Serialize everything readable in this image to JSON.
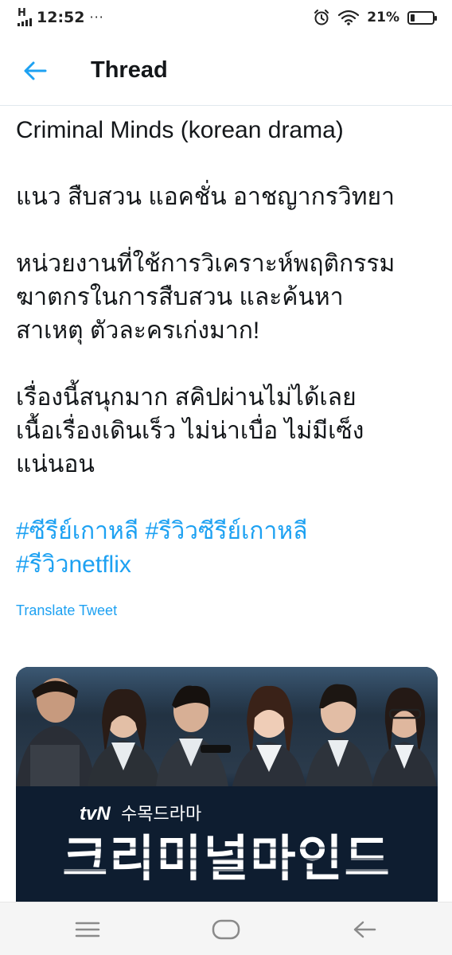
{
  "status_bar": {
    "network": "H",
    "time": "12:52",
    "overflow": "···",
    "battery_percent": "21%",
    "battery_level": 0.21,
    "icons": [
      "signal-icon",
      "alarm-icon",
      "wifi-icon",
      "battery-icon"
    ]
  },
  "header": {
    "back_icon": "arrow-left-icon",
    "title": "Thread"
  },
  "tweet": {
    "title_line": "Criminal Minds (korean drama)",
    "genre_line": "แนว สืบสวน แอคชั่น อาชญากรวิทยา",
    "description_lines": [
      "หน่วยงานที่ใช้การวิเคราะห์พฤติกรรม",
      "ฆาตกรในการสืบสวน และค้นหา",
      "สาเหตุ ตัวละครเก่งมาก!"
    ],
    "opinion_lines": [
      "เรื่องนี้สนุกมาก สคิปผ่านไม่ได้เลย",
      "เนื้อเรื่องเดินเร็ว ไม่น่าเบื่อ ไม่มีเซ็ง",
      "แน่นอน"
    ],
    "hashtags": [
      "#ซีรีย์เกาหลี",
      "#รีวิวซีรีย์เกาหลี",
      "#รีวิวnetflix"
    ],
    "translate_label": "Translate Tweet"
  },
  "media": {
    "channel": "tvN",
    "slot": "수목드라마",
    "series_title": "크리미널마인드"
  },
  "colors": {
    "link": "#1da1f2",
    "text": "#14171a",
    "divider": "#e1e8ed"
  },
  "nav_bar": {
    "icons": [
      "menu-icon",
      "home-icon",
      "back-icon"
    ]
  }
}
